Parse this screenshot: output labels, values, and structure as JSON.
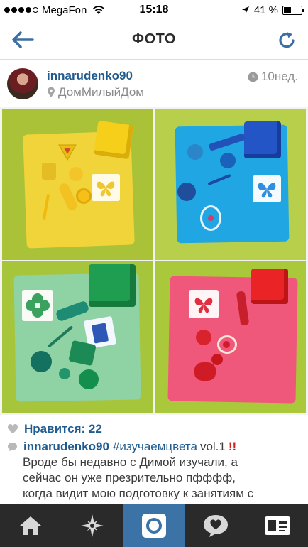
{
  "status_bar": {
    "carrier": "MegaFon",
    "time": "15:18",
    "battery_percent": "41 %",
    "battery_level": 0.41
  },
  "nav": {
    "title": "ФОТО"
  },
  "post": {
    "username": "innarudenko90",
    "location": "ДомМилыйДом",
    "time_ago": "10нед.",
    "likes": "Нравится: 22",
    "caption": {
      "username": "innarudenko90",
      "hashtag": "#изучаемцвета",
      "suffix": "vol.1",
      "emphasis": "!!",
      "line1": "Вроде бы недавно с Димой изучали, а",
      "line2": "сейчас он уже презрительно пфффф,",
      "line3": "когда видит мою подготовку к занятиям с"
    }
  },
  "tabs": [
    "home",
    "explore",
    "camera",
    "activity",
    "profile"
  ],
  "colors": {
    "link_blue": "#205b8f",
    "tab_bg": "#2a2a2a",
    "tab_active": "#3b73a6"
  }
}
